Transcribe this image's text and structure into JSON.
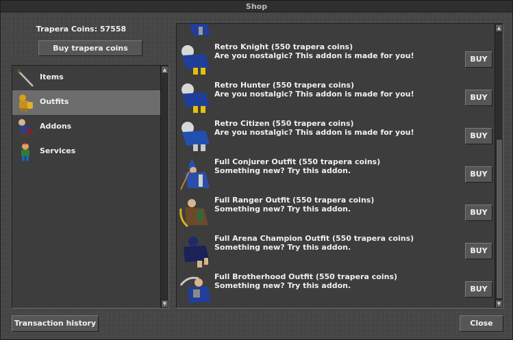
{
  "window": {
    "title": "Shop"
  },
  "balance": {
    "text": "Trapera Coins: 57558"
  },
  "buttons": {
    "buy_coins": "Buy trapera coins",
    "transaction_history": "Transaction history",
    "close": "Close"
  },
  "categories": [
    {
      "label": "Items",
      "icon": "sword-icon",
      "selected": false
    },
    {
      "label": "Outfits",
      "icon": "golden-armor-icon",
      "selected": true
    },
    {
      "label": "Addons",
      "icon": "addon-outfit-icon",
      "selected": false
    },
    {
      "label": "Services",
      "icon": "character-icon",
      "selected": false
    }
  ],
  "offers": [
    {
      "title": "Retro Knight (550 trapera coins)",
      "desc": "Are you nostalgic? This addon is made for you!",
      "buy": "BUY",
      "icon": "retro-knight-sprite"
    },
    {
      "title": "Retro Hunter (550 trapera coins)",
      "desc": "Are you nostalgic? This addon is made for you!",
      "buy": "BUY",
      "icon": "retro-hunter-sprite"
    },
    {
      "title": "Retro Citizen (550 trapera coins)",
      "desc": "Are you nostalgic? This addon is made for you!",
      "buy": "BUY",
      "icon": "retro-citizen-sprite"
    },
    {
      "title": "Full Conjurer Outfit (550 trapera coins)",
      "desc": "Something new? Try this addon.",
      "buy": "BUY",
      "icon": "conjurer-outfit-sprite"
    },
    {
      "title": "Full Ranger Outfit (550 trapera coins)",
      "desc": "Something new? Try this addon.",
      "buy": "BUY",
      "icon": "ranger-outfit-sprite"
    },
    {
      "title": "Full Arena Champion Outfit (550 trapera coins)",
      "desc": "Something new? Try this addon.",
      "buy": "BUY",
      "icon": "arena-champion-sprite"
    },
    {
      "title": "Full Brotherhood Outfit (550 trapera coins)",
      "desc": "Something new? Try this addon.",
      "buy": "BUY",
      "icon": "brotherhood-outfit-sprite"
    }
  ],
  "colors": {
    "window_bg": "#474747",
    "panel_bg": "#3d3d3d",
    "selected_row": "#6d6d6d",
    "text": "#f0f0f0"
  }
}
